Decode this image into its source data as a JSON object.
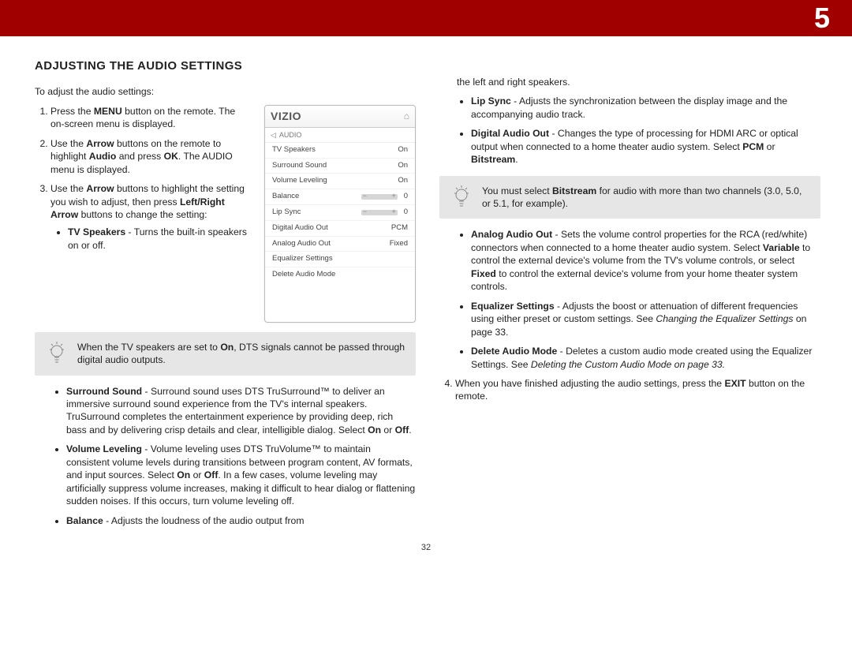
{
  "chapter": "5",
  "page_number": "32",
  "section_title": "ADJUSTING THE AUDIO SETTINGS",
  "intro": "To adjust the audio settings:",
  "step1": {
    "pre": "Press the ",
    "b1": "MENU",
    "post": " button on the remote. The on-screen menu is displayed."
  },
  "step2": {
    "a": "Use the ",
    "b1": "Arrow",
    "b": " buttons on the remote to highlight ",
    "b2": "Audio",
    "c": " and press ",
    "b3": "OK",
    "d": ". The AUDIO menu is displayed."
  },
  "step3": {
    "a": "Use the ",
    "b1": "Arrow",
    "b": " buttons to highlight the setting you wish to adjust, then press ",
    "b2": "Left/Right Arrow",
    "c": " buttons to change the setting:"
  },
  "tv_speakers": {
    "label": "TV Speakers",
    "text": " - Turns the built-in speakers on or off."
  },
  "callout1": {
    "a": "When the TV speakers are set to ",
    "b1": "On",
    "b": ", DTS signals cannot be passed through digital audio outputs."
  },
  "surround": {
    "label": "Surround Sound",
    "text": " - Surround sound uses DTS TruSurround™ to deliver an immersive surround sound experience from the TV's internal speakers. TruSurround completes the entertainment experience by providing deep, rich bass and by delivering crisp details and clear, intelligible dialog. Select ",
    "b1": "On",
    "mid": " or ",
    "b2": "Off",
    "end": "."
  },
  "leveling": {
    "label": "Volume Leveling",
    "text": " - Volume leveling uses DTS TruVolume™ to maintain consistent volume levels during transitions between program content, AV formats, and input sources. Select ",
    "b1": "On",
    "mid": " or ",
    "b2": "Off",
    "end": ". In a few cases, volume leveling may artificially suppress volume increases, making it difficult to hear dialog or flattening sudden noises. If this occurs, turn volume leveling off."
  },
  "balance": {
    "label": "Balance",
    "text": " - Adjusts the loudness of the audio output from"
  },
  "balance_cont": "the left and right speakers.",
  "lipsync": {
    "label": "Lip Sync",
    "text": " - Adjusts the synchronization between the display image and the accompanying audio track."
  },
  "dao": {
    "label": "Digital Audio Out",
    "text": " - Changes the type of processing for HDMI ARC or optical output when connected to a home theater audio system. Select ",
    "b1": "PCM",
    "mid": " or ",
    "b2": "Bitstream",
    "end": "."
  },
  "callout2": {
    "a": "You must select ",
    "b1": "Bitstream",
    "b": " for audio with more than two channels (3.0, 5.0, or 5.1, for example)."
  },
  "aao": {
    "label": "Analog Audio Out",
    "text": " - Sets the volume control properties for the RCA (red/white) connectors when connected to a home theater audio system. Select ",
    "b1": "Variable",
    "mid": " to control the external device's volume from the TV's volume controls, or select ",
    "b2": "Fixed",
    "end": " to control the external device's volume from your home theater system controls."
  },
  "eq": {
    "label": "Equalizer Settings",
    "text": " - Adjusts the boost or attenuation of different frequencies using either preset or custom settings. See ",
    "ref": "Changing the Equalizer Settings",
    "end": " on page 33."
  },
  "delmode": {
    "label": "Delete Audio Mode",
    "text": " - Deletes a custom audio mode created using the Equalizer Settings. See ",
    "ref": "Deleting the Custom Audio Mode on page 33.",
    "end": ""
  },
  "step4": {
    "a": "When you have finished adjusting the audio settings, press the ",
    "b1": "EXIT",
    "b": " button on the remote."
  },
  "osd": {
    "brand": "VIZIO",
    "crumb": "AUDIO",
    "rows": [
      {
        "label": "TV Speakers",
        "value": "On",
        "slider": false
      },
      {
        "label": "Surround Sound",
        "value": "On",
        "slider": false
      },
      {
        "label": "Volume Leveling",
        "value": "On",
        "slider": false
      },
      {
        "label": "Balance",
        "value": "0",
        "slider": true
      },
      {
        "label": "Lip Sync",
        "value": "0",
        "slider": true
      },
      {
        "label": "Digital Audio Out",
        "value": "PCM",
        "slider": false
      },
      {
        "label": "Analog Audio Out",
        "value": "Fixed",
        "slider": false
      },
      {
        "label": "Equalizer Settings",
        "value": "",
        "slider": false
      },
      {
        "label": "Delete Audio Mode",
        "value": "",
        "slider": false
      }
    ]
  }
}
